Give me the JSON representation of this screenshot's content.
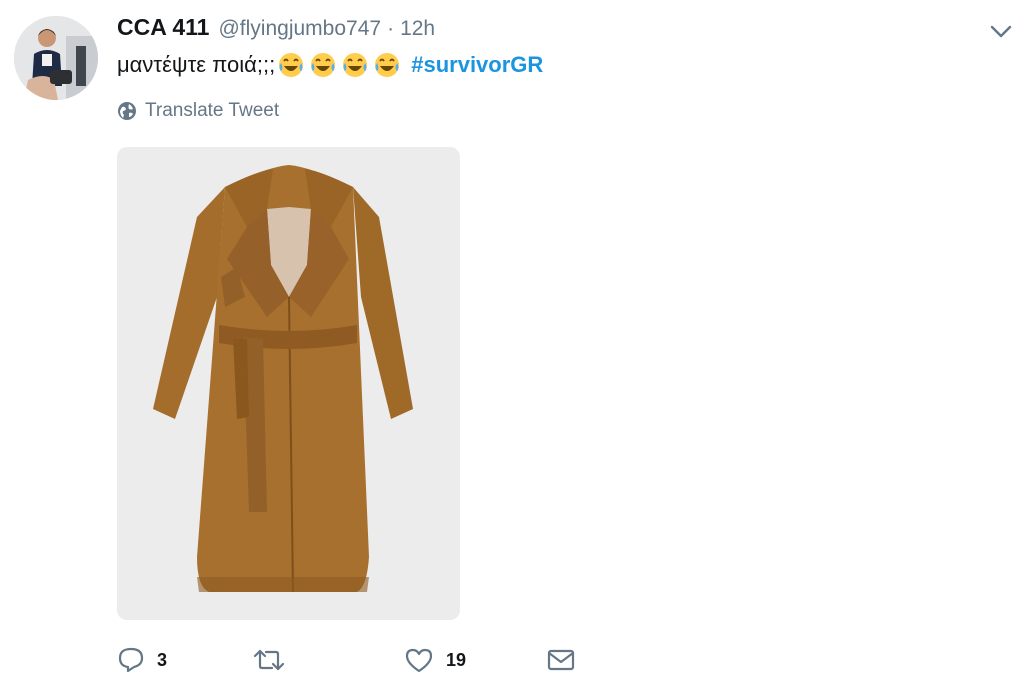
{
  "tweet": {
    "display_name": "CCA 411",
    "handle": "@flyingjumbo747",
    "separator": "·",
    "time": "12h",
    "text": "μαντέψτε ποιά;;;",
    "emojis": [
      "face-with-tears-of-joy-emoji",
      "face-with-tears-of-joy-emoji",
      "face-with-tears-of-joy-emoji",
      "face-with-tears-of-joy-emoji"
    ],
    "hashtag": "#survivorGR",
    "translate_label": "Translate Tweet"
  },
  "media": {
    "icon": "camel-wrap-coat-photo",
    "coat_color": "#a8702e",
    "background_color": "#ececec"
  },
  "actions": {
    "reply_count": "3",
    "retweet_count": "",
    "like_count": "19"
  },
  "colors": {
    "link": "#1b95e0",
    "secondary_text": "#657786",
    "primary_text": "#14171a"
  }
}
